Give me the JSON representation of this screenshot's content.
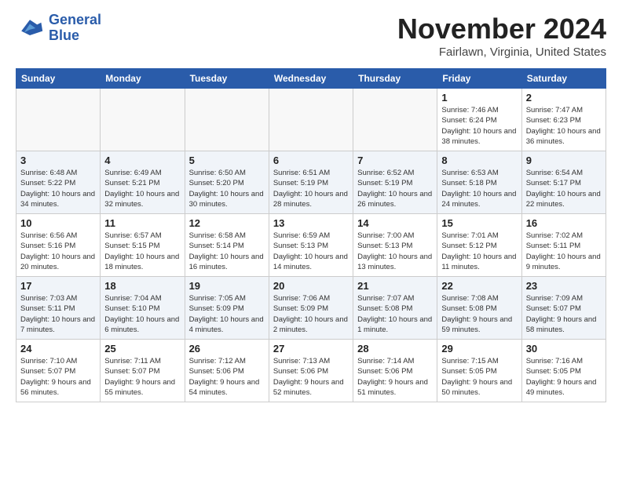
{
  "header": {
    "logo_line1": "General",
    "logo_line2": "Blue",
    "month": "November 2024",
    "location": "Fairlawn, Virginia, United States"
  },
  "weekdays": [
    "Sunday",
    "Monday",
    "Tuesday",
    "Wednesday",
    "Thursday",
    "Friday",
    "Saturday"
  ],
  "weeks": [
    [
      {
        "day": "",
        "info": ""
      },
      {
        "day": "",
        "info": ""
      },
      {
        "day": "",
        "info": ""
      },
      {
        "day": "",
        "info": ""
      },
      {
        "day": "",
        "info": ""
      },
      {
        "day": "1",
        "info": "Sunrise: 7:46 AM\nSunset: 6:24 PM\nDaylight: 10 hours and 38 minutes."
      },
      {
        "day": "2",
        "info": "Sunrise: 7:47 AM\nSunset: 6:23 PM\nDaylight: 10 hours and 36 minutes."
      }
    ],
    [
      {
        "day": "3",
        "info": "Sunrise: 6:48 AM\nSunset: 5:22 PM\nDaylight: 10 hours and 34 minutes."
      },
      {
        "day": "4",
        "info": "Sunrise: 6:49 AM\nSunset: 5:21 PM\nDaylight: 10 hours and 32 minutes."
      },
      {
        "day": "5",
        "info": "Sunrise: 6:50 AM\nSunset: 5:20 PM\nDaylight: 10 hours and 30 minutes."
      },
      {
        "day": "6",
        "info": "Sunrise: 6:51 AM\nSunset: 5:19 PM\nDaylight: 10 hours and 28 minutes."
      },
      {
        "day": "7",
        "info": "Sunrise: 6:52 AM\nSunset: 5:19 PM\nDaylight: 10 hours and 26 minutes."
      },
      {
        "day": "8",
        "info": "Sunrise: 6:53 AM\nSunset: 5:18 PM\nDaylight: 10 hours and 24 minutes."
      },
      {
        "day": "9",
        "info": "Sunrise: 6:54 AM\nSunset: 5:17 PM\nDaylight: 10 hours and 22 minutes."
      }
    ],
    [
      {
        "day": "10",
        "info": "Sunrise: 6:56 AM\nSunset: 5:16 PM\nDaylight: 10 hours and 20 minutes."
      },
      {
        "day": "11",
        "info": "Sunrise: 6:57 AM\nSunset: 5:15 PM\nDaylight: 10 hours and 18 minutes."
      },
      {
        "day": "12",
        "info": "Sunrise: 6:58 AM\nSunset: 5:14 PM\nDaylight: 10 hours and 16 minutes."
      },
      {
        "day": "13",
        "info": "Sunrise: 6:59 AM\nSunset: 5:13 PM\nDaylight: 10 hours and 14 minutes."
      },
      {
        "day": "14",
        "info": "Sunrise: 7:00 AM\nSunset: 5:13 PM\nDaylight: 10 hours and 13 minutes."
      },
      {
        "day": "15",
        "info": "Sunrise: 7:01 AM\nSunset: 5:12 PM\nDaylight: 10 hours and 11 minutes."
      },
      {
        "day": "16",
        "info": "Sunrise: 7:02 AM\nSunset: 5:11 PM\nDaylight: 10 hours and 9 minutes."
      }
    ],
    [
      {
        "day": "17",
        "info": "Sunrise: 7:03 AM\nSunset: 5:11 PM\nDaylight: 10 hours and 7 minutes."
      },
      {
        "day": "18",
        "info": "Sunrise: 7:04 AM\nSunset: 5:10 PM\nDaylight: 10 hours and 6 minutes."
      },
      {
        "day": "19",
        "info": "Sunrise: 7:05 AM\nSunset: 5:09 PM\nDaylight: 10 hours and 4 minutes."
      },
      {
        "day": "20",
        "info": "Sunrise: 7:06 AM\nSunset: 5:09 PM\nDaylight: 10 hours and 2 minutes."
      },
      {
        "day": "21",
        "info": "Sunrise: 7:07 AM\nSunset: 5:08 PM\nDaylight: 10 hours and 1 minute."
      },
      {
        "day": "22",
        "info": "Sunrise: 7:08 AM\nSunset: 5:08 PM\nDaylight: 9 hours and 59 minutes."
      },
      {
        "day": "23",
        "info": "Sunrise: 7:09 AM\nSunset: 5:07 PM\nDaylight: 9 hours and 58 minutes."
      }
    ],
    [
      {
        "day": "24",
        "info": "Sunrise: 7:10 AM\nSunset: 5:07 PM\nDaylight: 9 hours and 56 minutes."
      },
      {
        "day": "25",
        "info": "Sunrise: 7:11 AM\nSunset: 5:07 PM\nDaylight: 9 hours and 55 minutes."
      },
      {
        "day": "26",
        "info": "Sunrise: 7:12 AM\nSunset: 5:06 PM\nDaylight: 9 hours and 54 minutes."
      },
      {
        "day": "27",
        "info": "Sunrise: 7:13 AM\nSunset: 5:06 PM\nDaylight: 9 hours and 52 minutes."
      },
      {
        "day": "28",
        "info": "Sunrise: 7:14 AM\nSunset: 5:06 PM\nDaylight: 9 hours and 51 minutes."
      },
      {
        "day": "29",
        "info": "Sunrise: 7:15 AM\nSunset: 5:05 PM\nDaylight: 9 hours and 50 minutes."
      },
      {
        "day": "30",
        "info": "Sunrise: 7:16 AM\nSunset: 5:05 PM\nDaylight: 9 hours and 49 minutes."
      }
    ]
  ]
}
